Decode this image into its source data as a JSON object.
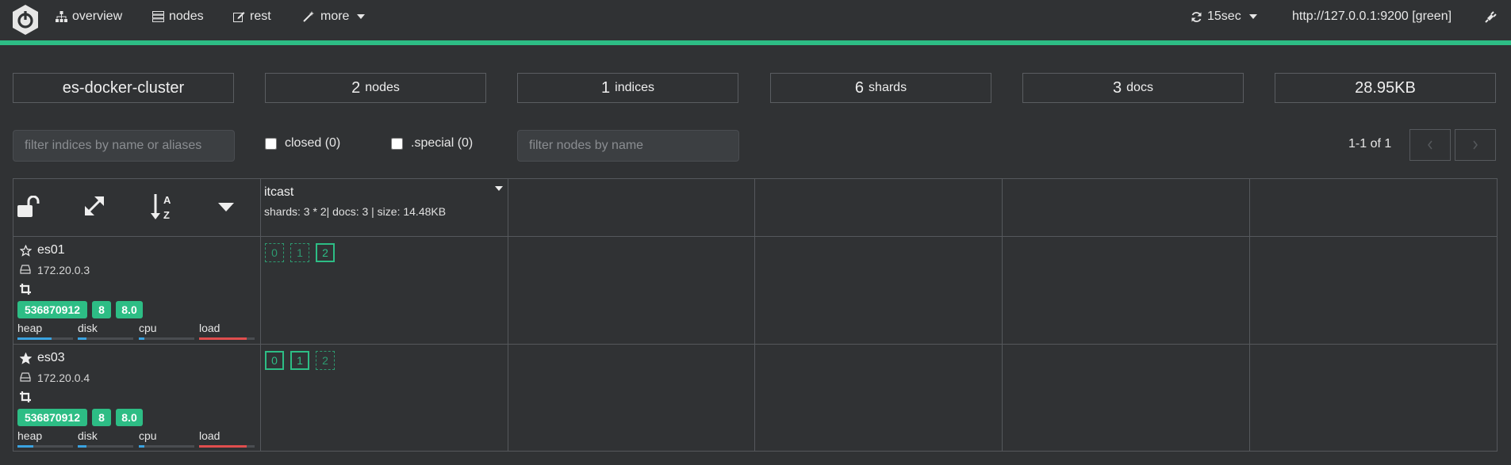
{
  "nav": {
    "overview": "overview",
    "nodes": "nodes",
    "rest": "rest",
    "more": "more",
    "refresh": "15sec",
    "cluster_url": "http://127.0.0.1:9200 [green]"
  },
  "colors": {
    "accent": "#2dbd85",
    "background": "#303234",
    "heap": "#3aa2e0",
    "load": "#e04e4e"
  },
  "stats": {
    "cluster_name": "es-docker-cluster",
    "nodes_value": "2",
    "nodes_label": "nodes",
    "indices_value": "1",
    "indices_label": "indices",
    "shards_value": "6",
    "shards_label": "shards",
    "docs_value": "3",
    "docs_label": "docs",
    "size": "28.95KB"
  },
  "filters": {
    "indices_placeholder": "filter indices by name or aliases",
    "closed_label": "closed (0)",
    "special_label": ".special (0)",
    "nodes_placeholder": "filter nodes by name"
  },
  "pager": {
    "text": "1-1 of 1"
  },
  "toolbar_icons": [
    "unlock-icon",
    "expand-icon",
    "sort-alpha-icon",
    "caret-down-icon"
  ],
  "index": {
    "name": "itcast",
    "meta": "shards: 3 * 2| docs: 3 | size: 14.48KB"
  },
  "nodes": [
    {
      "name": "es01",
      "master": false,
      "ip": "172.20.0.3",
      "badges": [
        "536870912",
        "8",
        "8.0"
      ],
      "metrics": {
        "heap": "heap",
        "disk": "disk",
        "cpu": "cpu",
        "load": "load"
      },
      "metric_levels": {
        "heap": 0.62,
        "disk": 0.15,
        "cpu": 0.1,
        "load": 0.85
      },
      "shards": [
        {
          "label": "0",
          "primary": false
        },
        {
          "label": "1",
          "primary": false
        },
        {
          "label": "2",
          "primary": true
        }
      ]
    },
    {
      "name": "es03",
      "master": true,
      "ip": "172.20.0.4",
      "badges": [
        "536870912",
        "8",
        "8.0"
      ],
      "metrics": {
        "heap": "heap",
        "disk": "disk",
        "cpu": "cpu",
        "load": "load"
      },
      "metric_levels": {
        "heap": 0.28,
        "disk": 0.15,
        "cpu": 0.1,
        "load": 0.85
      },
      "shards": [
        {
          "label": "0",
          "primary": true
        },
        {
          "label": "1",
          "primary": true
        },
        {
          "label": "2",
          "primary": false
        }
      ]
    }
  ]
}
